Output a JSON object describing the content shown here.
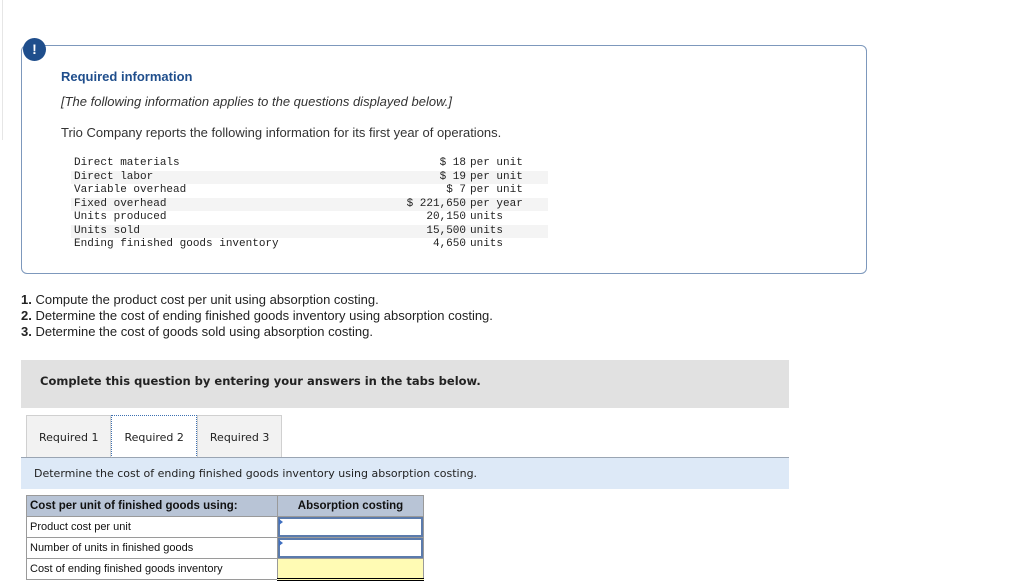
{
  "alert": {
    "icon": "exclamation-icon",
    "glyph": "!"
  },
  "info": {
    "title": "Required information",
    "note": "[The following information applies to the questions displayed below.]",
    "intro": "Trio Company reports the following information for its first year of operations.",
    "facts": [
      {
        "label": "Direct materials",
        "value": "$ 18",
        "unit": "per unit"
      },
      {
        "label": "Direct labor",
        "value": "$ 19",
        "unit": "per unit"
      },
      {
        "label": "Variable overhead",
        "value": "$ 7",
        "unit": "per unit"
      },
      {
        "label": "Fixed overhead",
        "value": "$ 221,650",
        "unit": "per year"
      },
      {
        "label": "Units produced",
        "value": "20,150",
        "unit": "units"
      },
      {
        "label": "Units sold",
        "value": "15,500",
        "unit": "units"
      },
      {
        "label": "Ending finished goods inventory",
        "value": "4,650",
        "unit": "units"
      }
    ]
  },
  "questions": [
    {
      "num": "1.",
      "text": " Compute the product cost per unit using absorption costing."
    },
    {
      "num": "2.",
      "text": " Determine the cost of ending finished goods inventory using absorption costing."
    },
    {
      "num": "3.",
      "text": " Determine the cost of goods sold using absorption costing."
    }
  ],
  "instruction": "Complete this question by entering your answers in the tabs below.",
  "tabs": [
    {
      "label": "Required 1",
      "active": false
    },
    {
      "label": "Required 2",
      "active": true
    },
    {
      "label": "Required 3",
      "active": false
    }
  ],
  "tab_prompt": "Determine the cost of ending finished goods inventory using absorption costing.",
  "answer_table": {
    "header": [
      "Cost per unit of finished goods using:",
      "Absorption costing"
    ],
    "rows": [
      {
        "label": "Product cost per unit",
        "value": ""
      },
      {
        "label": "Number of units in finished goods",
        "value": ""
      },
      {
        "label": "Cost of ending finished goods inventory",
        "value": ""
      }
    ]
  }
}
